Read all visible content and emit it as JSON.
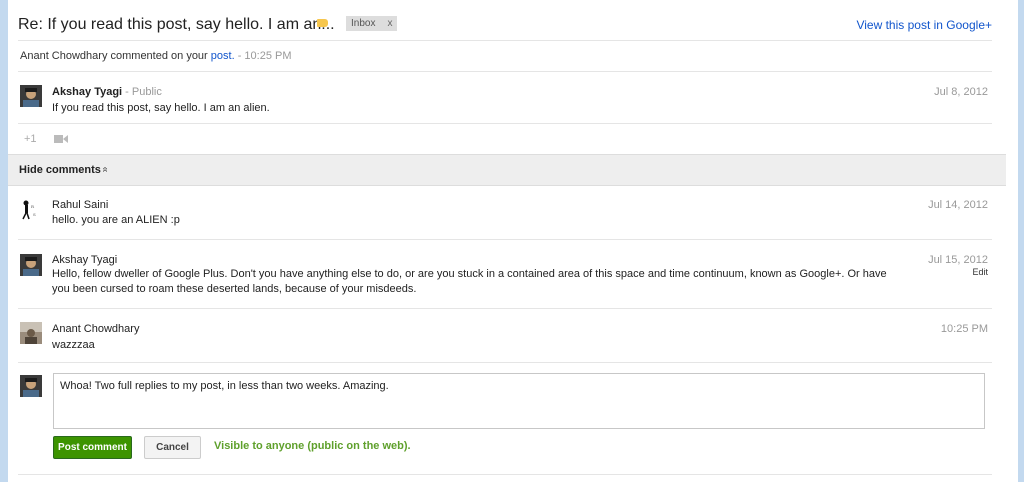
{
  "header": {
    "subject": "Re: If you read this post, say hello. I am an...",
    "inbox_label": "Inbox",
    "inbox_close": "x",
    "view_link": "View this post in Google+"
  },
  "notification": {
    "prefix": "Anant Chowdhary commented on your ",
    "link": "post.",
    "separator": " - ",
    "time": "10:25 PM"
  },
  "post": {
    "author": "Akshay Tyagi",
    "visibility": " - Public",
    "text": "If you read this post, say hello. I am an alien.",
    "date": "Jul 8, 2012"
  },
  "actions": {
    "plus_one": "+1"
  },
  "hide_comments": {
    "label": "Hide comments",
    "chevron": "»"
  },
  "comments": [
    {
      "author": "Rahul Saini",
      "text": "hello. you are an ALIEN :p",
      "date": "Jul 14, 2012"
    },
    {
      "author": "Akshay Tyagi",
      "text": "Hello, fellow dweller of Google Plus. Don't you have anything else to do, or are you stuck in a contained area of this space and time continuum, known as Google+. Or have you been cursed to roam these deserted lands, because of your misdeeds.",
      "date": "Jul 15, 2012",
      "edit": "Edit"
    },
    {
      "author": "Anant Chowdhary",
      "text": "wazzzaa",
      "date": "10:25 PM"
    }
  ],
  "reply": {
    "value": "Whoa! Two full replies to my post, in less than two weeks. Amazing.",
    "post_button": "Post comment",
    "cancel_button": "Cancel",
    "visibility_note": "Visible to anyone (public on the web)."
  },
  "colors": {
    "link": "#1155cc",
    "post_button": "#3d9400",
    "visibility_note": "#5fa02c",
    "page_background": "#c3d9ef"
  }
}
